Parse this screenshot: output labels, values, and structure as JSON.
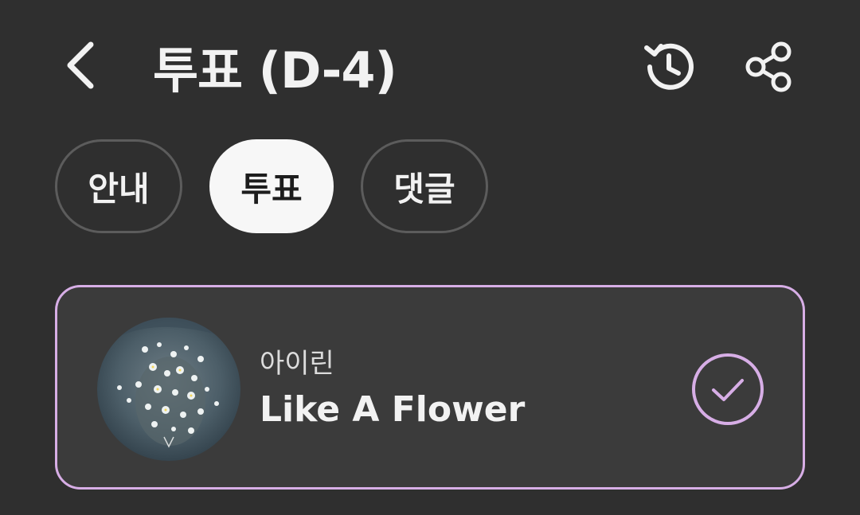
{
  "header": {
    "back_icon": "chevron-left-icon",
    "title": "투표 (D-4)",
    "history_icon": "history-icon",
    "share_icon": "share-icon"
  },
  "tabs": [
    {
      "label": "안내",
      "selected": false
    },
    {
      "label": "투표",
      "selected": true
    },
    {
      "label": "댓글",
      "selected": false
    }
  ],
  "vote_item": {
    "artist": "아이린",
    "song": "Like A Flower",
    "selected": true,
    "check_icon": "check-circle-icon",
    "accent_color": "#d7aee6"
  },
  "colors": {
    "background": "#2f2f2f",
    "card": "#3b3b3b",
    "accent": "#d7aee6"
  }
}
